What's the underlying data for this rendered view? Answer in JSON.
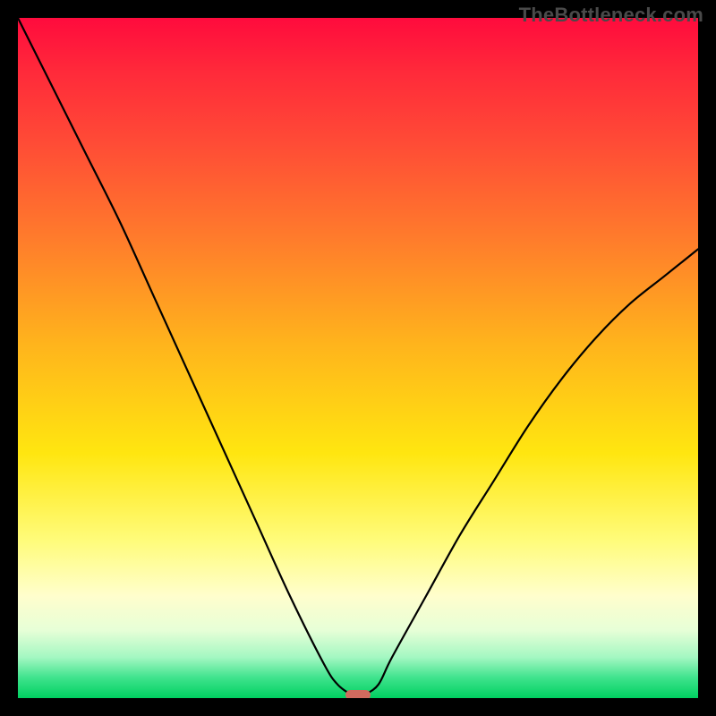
{
  "watermark": "TheBottleneck.com",
  "colors": {
    "frame_border": "#000000",
    "curve": "#000000",
    "valley_marker": "#d16a5e",
    "watermark": "#4a4a4a",
    "gradient_stops": [
      "#ff0b3d",
      "#ff2a3a",
      "#ff4a36",
      "#ff7a2c",
      "#ffb41c",
      "#ffe610",
      "#fffc7c",
      "#fffecd",
      "#e7ffd7",
      "#a4f7c2",
      "#3fe38d",
      "#00d060"
    ]
  },
  "chart_data": {
    "type": "line",
    "title": "",
    "xlabel": "",
    "ylabel": "",
    "xlim": [
      0,
      100
    ],
    "ylim": [
      0,
      100
    ],
    "grid": false,
    "legend_position": "none",
    "series": [
      {
        "name": "bottleneck-curve",
        "x": [
          0,
          5,
          10,
          15,
          20,
          25,
          30,
          35,
          40,
          45,
          47,
          49,
          50,
          51,
          53,
          55,
          60,
          65,
          70,
          75,
          80,
          85,
          90,
          95,
          100
        ],
        "y": [
          100,
          90,
          80,
          70,
          59,
          48,
          37,
          26,
          15,
          5,
          2,
          0.5,
          0,
          0.5,
          2,
          6,
          15,
          24,
          32,
          40,
          47,
          53,
          58,
          62,
          66
        ]
      }
    ],
    "annotations": [
      {
        "name": "valley-marker",
        "x": 50,
        "y": 0,
        "color": "#d16a5e",
        "shape": "rounded-rect"
      }
    ],
    "background": {
      "type": "vertical-gradient",
      "description": "red (high mismatch) to green (ideal match) spectrum",
      "stops_top_to_bottom": [
        "red",
        "orange",
        "yellow",
        "pale-yellow",
        "pale-green",
        "green"
      ]
    }
  }
}
